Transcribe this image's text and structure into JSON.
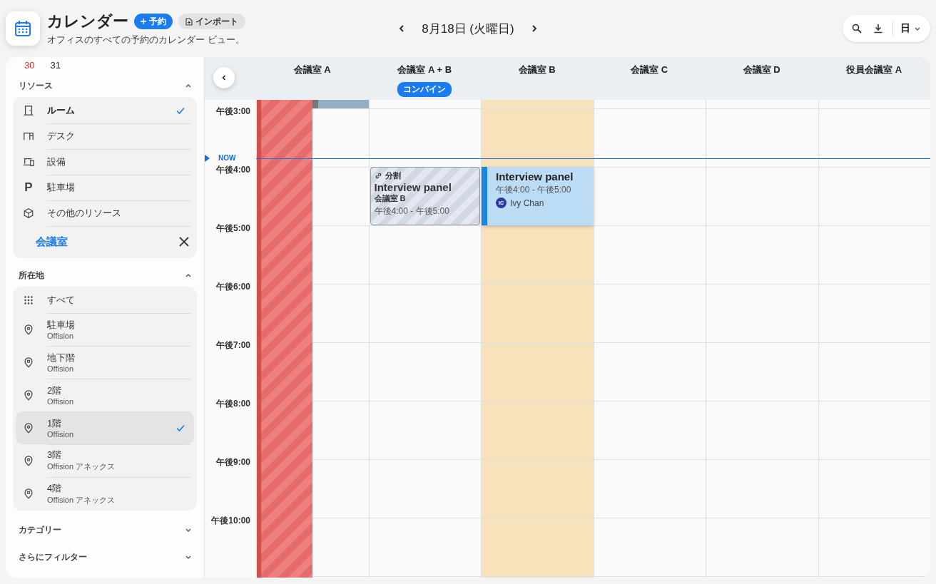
{
  "header": {
    "title": "カレンダー",
    "subtitle": "オフィスのすべての予約のカレンダー ビュー。",
    "new_button": "予約",
    "import_button": "インポート"
  },
  "date_nav": {
    "label": "8月18日 (火曜日)"
  },
  "toolbar": {
    "view": "日"
  },
  "mini_calendar": {
    "days": [
      {
        "label": "30",
        "weekend": true
      },
      {
        "label": "31",
        "weekend": false
      }
    ]
  },
  "resources": {
    "title": "リソース",
    "expanded": true,
    "items": [
      {
        "kind": "door",
        "label": "ルーム",
        "selected": true
      },
      {
        "kind": "desk",
        "label": "デスク",
        "selected": false
      },
      {
        "kind": "device",
        "label": "設備",
        "selected": false
      },
      {
        "kind": "glyph",
        "glyph": "P",
        "label": "駐車場",
        "selected": false
      },
      {
        "kind": "box",
        "label": "その他のリソース",
        "selected": false
      }
    ],
    "search": {
      "value": "会議室"
    }
  },
  "locations": {
    "title": "所在地",
    "expanded": true,
    "items": [
      {
        "kind": "all",
        "label": "すべて",
        "selected": false
      },
      {
        "kind": "pin",
        "label": "駐車場",
        "sub": "Offision",
        "selected": false
      },
      {
        "kind": "pin",
        "label": "地下階",
        "sub": "Offision",
        "selected": false
      },
      {
        "kind": "pin",
        "label": "2階",
        "sub": "Offision",
        "selected": false
      },
      {
        "kind": "pin",
        "label": "1階",
        "sub": "Offision",
        "selected": true
      },
      {
        "kind": "pin",
        "label": "3階",
        "sub": "Offision アネックス",
        "selected": false
      },
      {
        "kind": "pin",
        "label": "4階",
        "sub": "Offision アネックス",
        "selected": false
      }
    ]
  },
  "filters": [
    {
      "label": "カテゴリー",
      "expanded": false
    },
    {
      "label": "さらにフィルター",
      "expanded": false
    }
  ],
  "calendar": {
    "now_label": "NOW",
    "columns": [
      {
        "name": "会議室 A",
        "blocked": true,
        "highlighted": false,
        "events": [
          {
            "kind": "block"
          }
        ]
      },
      {
        "name": "会議室 A + B",
        "badge": "コンバイン",
        "blocked": false,
        "highlighted": false,
        "events": [
          {
            "kind": "split",
            "tag": "分割",
            "title": "Interview panel",
            "room": "会議室 B",
            "time": "午後4:00 - 午後5:00"
          }
        ]
      },
      {
        "name": "会議室 B",
        "blocked": false,
        "highlighted": true,
        "events": [
          {
            "kind": "booking",
            "title": "Interview panel",
            "time": "午後4:00 - 午後5:00",
            "person": "Ivy Chan",
            "initials": "IC"
          }
        ]
      },
      {
        "name": "会議室 C",
        "blocked": false,
        "highlighted": false
      },
      {
        "name": "会議室 D",
        "blocked": false,
        "highlighted": false
      },
      {
        "name": "役員会議室 A",
        "blocked": false,
        "highlighted": false
      }
    ],
    "times": [
      "午後3:00",
      "午後4:00",
      "午後5:00",
      "午後6:00",
      "午後7:00",
      "午後8:00",
      "午後9:00",
      "午後10:00"
    ]
  }
}
